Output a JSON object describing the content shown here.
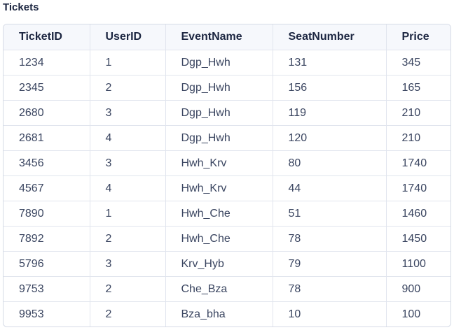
{
  "title": "Tickets",
  "table": {
    "columns": [
      "TicketID",
      "UserID",
      "EventName",
      "SeatNumber",
      "Price"
    ],
    "rows": [
      [
        "1234",
        "1",
        "Dgp_Hwh",
        "131",
        "345"
      ],
      [
        "2345",
        "2",
        "Dgp_Hwh",
        "156",
        "165"
      ],
      [
        "2680",
        "3",
        "Dgp_Hwh",
        "119",
        "210"
      ],
      [
        "2681",
        "4",
        "Dgp_Hwh",
        "120",
        "210"
      ],
      [
        "3456",
        "3",
        "Hwh_Krv",
        "80",
        "1740"
      ],
      [
        "4567",
        "4",
        "Hwh_Krv",
        "44",
        "1740"
      ],
      [
        "7890",
        "1",
        "Hwh_Che",
        "51",
        "1460"
      ],
      [
        "7892",
        "2",
        "Hwh_Che",
        "78",
        "1450"
      ],
      [
        "5796",
        "3",
        "Krv_Hyb",
        "79",
        "1100"
      ],
      [
        "9753",
        "2",
        "Che_Bza",
        "78",
        "900"
      ],
      [
        "9953",
        "2",
        "Bza_bha",
        "10",
        "100"
      ]
    ]
  }
}
